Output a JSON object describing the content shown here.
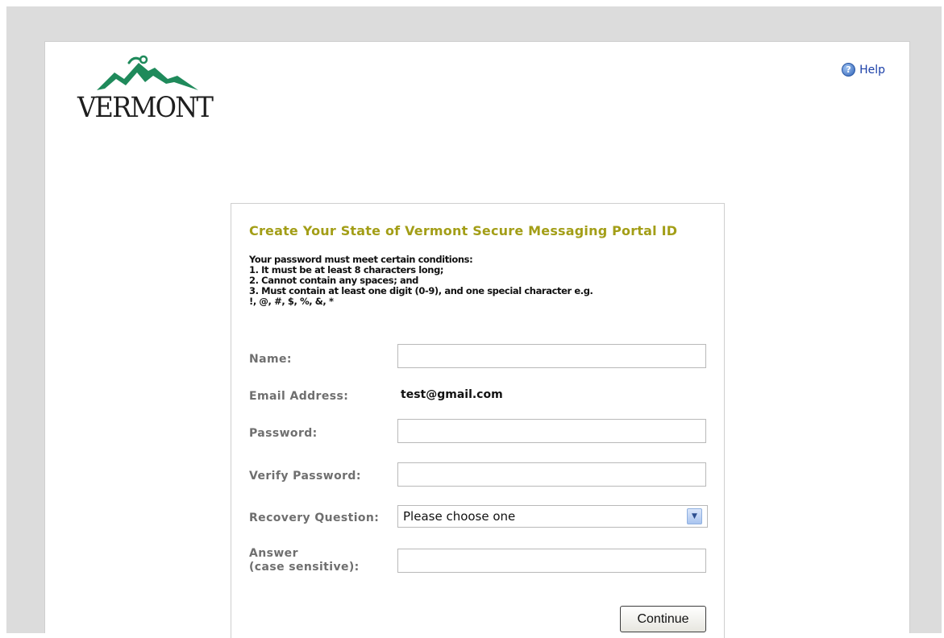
{
  "logo": {
    "text": "VERMONT"
  },
  "header": {
    "help_label": "Help",
    "help_icon": "help-icon"
  },
  "form": {
    "title": "Create Your State of Vermont Secure Messaging Portal ID",
    "rules": [
      "Your password must meet certain conditions:",
      "1. It must be at least 8 characters long;",
      "2. Cannot contain any spaces; and",
      "3. Must contain at least one digit (0-9), and one special character e.g.",
      "!, @, #, $, %, &, *"
    ],
    "fields": {
      "name_label": "Name:",
      "name_value": "",
      "email_label": "Email Address:",
      "email_value": "test@gmail.com",
      "password_label": "Password:",
      "password_value": "",
      "verify_label": "Verify Password:",
      "verify_value": "",
      "question_label": "Recovery Question:",
      "question_selected": "Please choose one",
      "answer_label_line1": "Answer",
      "answer_label_line2": "(case sensitive):",
      "answer_value": ""
    },
    "continue_label": "Continue"
  },
  "colors": {
    "title": "#a39e17",
    "logo_green": "#1f8a5b",
    "backdrop": "#dcdcdc",
    "label": "#6f6f6f",
    "help_link": "#1a3fa8"
  }
}
